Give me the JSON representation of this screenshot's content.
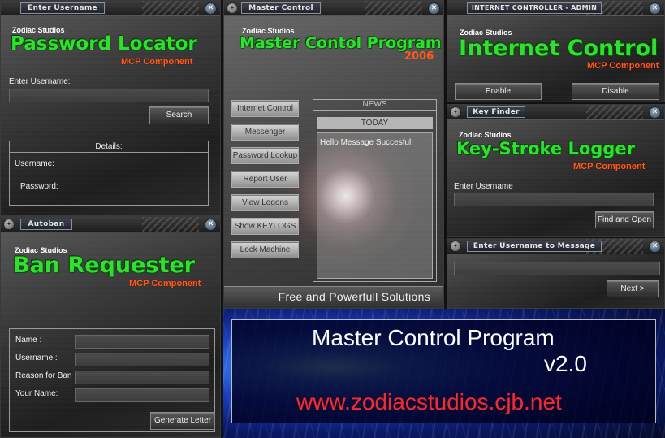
{
  "password_panel": {
    "title": "Enter Username",
    "studio": "Zodiac Studios",
    "heading": "Password Locator",
    "component": "MCP Component",
    "username_label": "Enter Username:",
    "username_value": "",
    "search_label": "Search",
    "details_title": "Details:",
    "details_username_label": "Username:",
    "details_password_label": "Password:"
  },
  "autoban_panel": {
    "title": "Autoban",
    "studio": "Zodiac Studios",
    "heading": "Ban Requester",
    "component": "MCP Component",
    "fields": [
      {
        "label": "Name :",
        "value": ""
      },
      {
        "label": "Username :",
        "value": ""
      },
      {
        "label": "Reason for Ban",
        "value": ""
      },
      {
        "label": "Your Name:",
        "value": ""
      }
    ],
    "generate_label": "Generate Letter"
  },
  "master_panel": {
    "title": "Master Control",
    "studio": "Zodiac Studios",
    "heading": "Master Contol Program",
    "year": "2006",
    "menu": [
      "Internet Control",
      "Messenger",
      "Password Lookup",
      "Report User",
      "View Logons",
      "Show KEYLOGS",
      "Lock Machine"
    ],
    "news_title": "NEWS",
    "today_label": "TODAY",
    "news_message": "Hello Message Succesful!",
    "tagline": "Free and Powerfull Solutions"
  },
  "internet_panel": {
    "title": "INTERNET CONTROLLER - ADMIN",
    "studio": "Zodiac Studios",
    "heading": "Internet Control",
    "component": "MCP Component",
    "enable_label": "Enable",
    "disable_label": "Disable"
  },
  "keyfinder_panel": {
    "title": "Key Finder",
    "studio": "Zodiac Studios",
    "heading": "Key-Stroke Logger",
    "component": "MCP Component",
    "username_label": "Enter Username",
    "username_value": "",
    "find_label": "Find and Open"
  },
  "message_panel": {
    "title": "Enter Username to Message",
    "username_value": "",
    "next_label": "Next >"
  },
  "banner": {
    "title": "Master Control Program",
    "version": "v2.0",
    "url": "www.zodiacstudios.cjb.net"
  },
  "icons": {
    "window_icon": "compass-icon",
    "close_icon": "close-icon"
  },
  "colors": {
    "heading_green": "#2ee02e",
    "component_orange": "#ff5a1a",
    "banner_blue": "#1e4fd8",
    "url_red": "#e8303a"
  }
}
